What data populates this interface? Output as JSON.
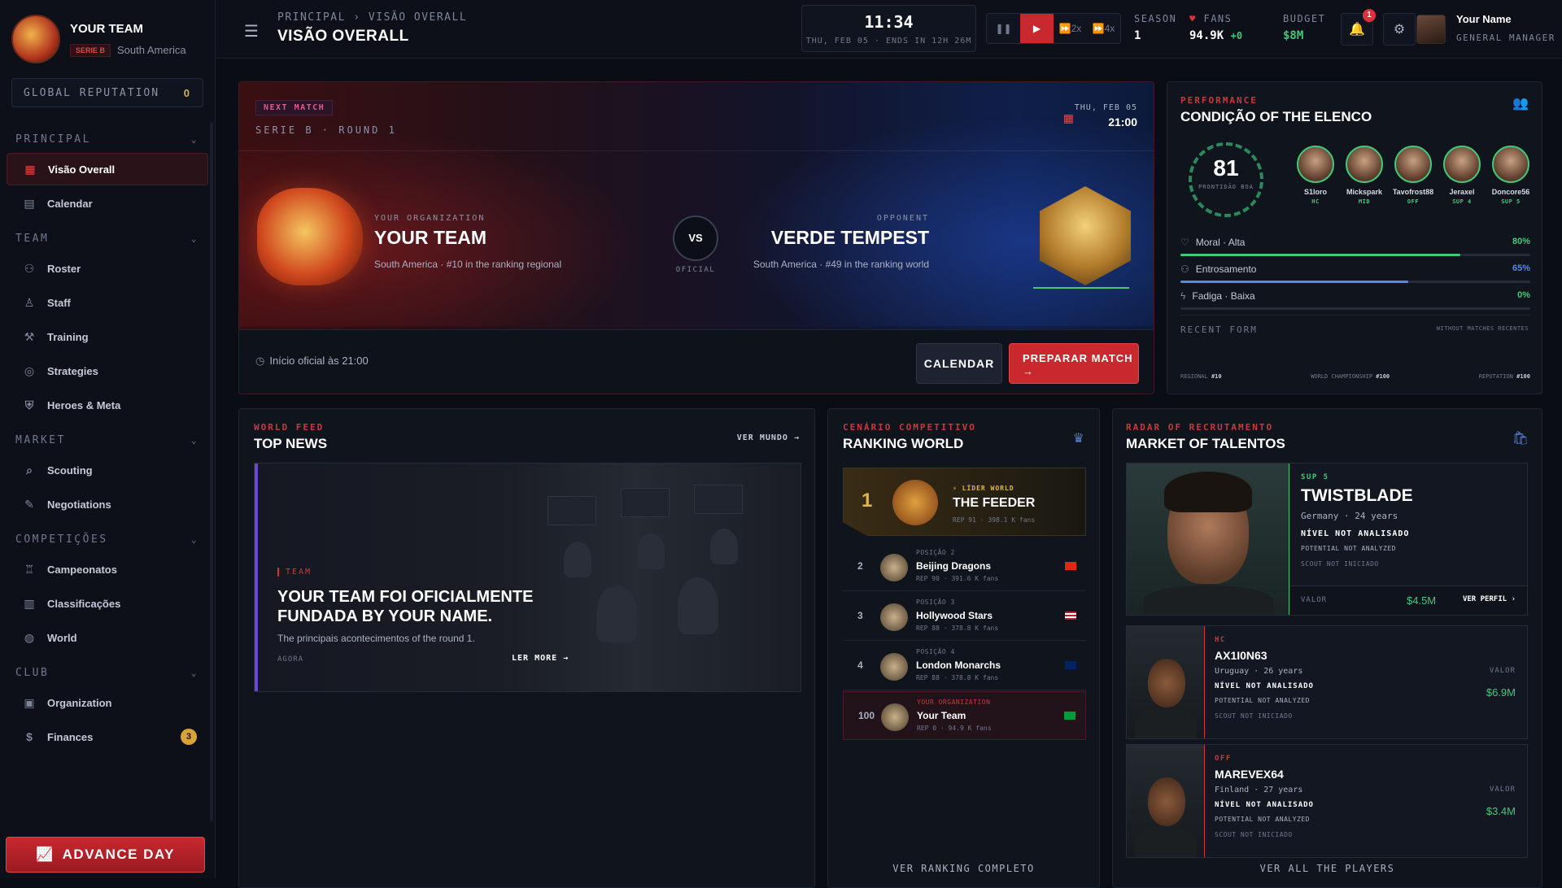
{
  "sidebar": {
    "team_name": "YOUR TEAM",
    "serie_badge": "SERIE B",
    "region": "South America",
    "reputation_label": "GLOBAL REPUTATION",
    "reputation_value": "0",
    "sections": [
      {
        "title": "PRINCIPAL",
        "items": [
          {
            "label": "Visão Overall",
            "icon": "grid-icon",
            "active": true
          },
          {
            "label": "Calendar",
            "icon": "calendar-icon"
          }
        ]
      },
      {
        "title": "TEAM",
        "items": [
          {
            "label": "Roster",
            "icon": "users-icon"
          },
          {
            "label": "Staff",
            "icon": "user-tie-icon"
          },
          {
            "label": "Training",
            "icon": "dumbbell-icon"
          },
          {
            "label": "Strategies",
            "icon": "target-icon"
          },
          {
            "label": "Heroes & Meta",
            "icon": "shield-icon"
          }
        ]
      },
      {
        "title": "MARKET",
        "items": [
          {
            "label": "Scouting",
            "icon": "search-icon"
          },
          {
            "label": "Negotiations",
            "icon": "edit-icon"
          }
        ]
      },
      {
        "title": "COMPETIÇÕES",
        "items": [
          {
            "label": "Campeonatos",
            "icon": "trophy-icon"
          },
          {
            "label": "Classificações",
            "icon": "bar-chart-icon"
          },
          {
            "label": "World",
            "icon": "globe-icon"
          }
        ]
      },
      {
        "title": "CLUB",
        "items": [
          {
            "label": "Organization",
            "icon": "building-icon"
          },
          {
            "label": "Finances",
            "icon": "dollar-icon",
            "badge": "3"
          }
        ]
      }
    ],
    "advance_label": "ADVANCE DAY"
  },
  "topbar": {
    "breadcrumb": "PRINCIPAL › VISÃO OVERALL",
    "title": "VISÃO OVERALL",
    "time": "11:34",
    "date": "THU, FEB 05 · ENDS IN 12H 26M",
    "speed_2x": "2x",
    "speed_4x": "4x",
    "season_label": "SEASON",
    "season_value": "1",
    "fans_label": "FANS",
    "fans_value": "94.9K",
    "fans_delta": "+0",
    "budget_label": "BUDGET",
    "budget_value": "$8M",
    "notifications": "1",
    "user_name": "Your Name",
    "user_role": "GENERAL MANAGER"
  },
  "match": {
    "badge": "NEXT MATCH",
    "round": "SERIE B · ROUND 1",
    "date": "THU, FEB 05",
    "time": "21:00",
    "home_label": "YOUR ORGANIZATION",
    "home_name": "YOUR TEAM",
    "home_sub": "South America · #10 in the ranking regional",
    "vs": "VS",
    "vs_label": "OFICIAL",
    "away_label": "OPPONENT",
    "away_name": "VERDE TEMPEST",
    "away_sub": "South America · #49 in the ranking world",
    "start_text": "Início oficial às 21:00",
    "calendar_button": "CALENDAR",
    "prepare_button": "PREPARAR MATCH →"
  },
  "performance": {
    "eyebrow": "PERFORMANCE",
    "title": "CONDIÇÃO OF THE ELENCO",
    "score": "81",
    "score_label": "PRONTIDÃO BOA",
    "players": [
      {
        "name": "S1loro",
        "pos": "HC"
      },
      {
        "name": "Mickspark",
        "pos": "MID"
      },
      {
        "name": "Tavofrost88",
        "pos": "OFF"
      },
      {
        "name": "Jeraxel",
        "pos": "SUP 4"
      },
      {
        "name": "Doncore56",
        "pos": "SUP 5"
      }
    ],
    "bars": [
      {
        "label": "Moral · Alta",
        "value": "80%",
        "fill": 0.8,
        "color": "#3fca7a",
        "icon": "heart-icon"
      },
      {
        "label": "Entrosamento",
        "value": "65%",
        "fill": 0.65,
        "color": "#5a8ae0",
        "icon": "users-icon"
      },
      {
        "label": "Fadiga · Baixa",
        "value": "0%",
        "fill": 0,
        "color": "#3fca7a",
        "icon": "bolt-icon"
      }
    ],
    "recent_form_label": "RECENT FORM",
    "recent_form_empty": "WITHOUT MATCHES RECENTES",
    "foot": [
      {
        "label": "REGIONAL",
        "value": "#10"
      },
      {
        "label": "WORLD CHAMPIONSHIP",
        "value": "#100"
      },
      {
        "label": "REPUTATION",
        "value": "#100"
      }
    ]
  },
  "news": {
    "eyebrow": "WORLD FEED",
    "title": "TOP NEWS",
    "link": "VER MUNDO →",
    "tag": "TEAM",
    "headline": "YOUR TEAM FOI OFICIALMENTE FUNDADA BY YOUR NAME.",
    "body": "The principais acontecimentos of the round 1.",
    "time": "AGORA",
    "more": "LER MORE →"
  },
  "ranking": {
    "eyebrow": "CENÁRIO COMPETITIVO",
    "title": "RANKING WORLD",
    "leader": {
      "pos": "1",
      "tag": "⚡ LÍDER WORLD",
      "name": "THE FEEDER",
      "rep": "REP 91 · 398.1 K fans"
    },
    "rows": [
      {
        "pos": "2",
        "label": "POSIÇÃO 2",
        "name": "Beijing Dragons",
        "rep": "REP 90 · 391.6 K fans",
        "flag": "cn"
      },
      {
        "pos": "3",
        "label": "POSIÇÃO 3",
        "name": "Hollywood Stars",
        "rep": "REP 88 · 378.8 K fans",
        "flag": "us"
      },
      {
        "pos": "4",
        "label": "POSIÇÃO 4",
        "name": "London Monarchs",
        "rep": "REP 88 · 378.8 K fans",
        "flag": "gb"
      },
      {
        "pos": "100",
        "label": "YOUR ORGANIZATION",
        "name": "Your Team",
        "rep": "REP 0 · 94.9 K fans",
        "flag": "br"
      }
    ],
    "footer": "VER RANKING COMPLETO"
  },
  "market": {
    "eyebrow": "RADAR OF RECRUTAMENTO",
    "title": "MARKET OF TALENTOS",
    "featured": {
      "role": "SUP 5",
      "name": "TWISTBLADE",
      "meta": "Germany · 24 years",
      "nivel": "NÍVEL NOT ANALISADO",
      "potential": "POTENTIAL NOT ANALYZED",
      "scout": "SCOUT NOT INICIADO",
      "value_label": "VALOR",
      "value": "$4.5M",
      "profile": "VER PERFIL ›"
    },
    "players": [
      {
        "role": "HC",
        "name": "AX1I0N63",
        "meta": "Uruguay · 26 years",
        "nivel": "NÍVEL NOT ANALISADO",
        "potential": "POTENTIAL NOT ANALYZED",
        "scout": "SCOUT NOT INICIADO",
        "value_label": "VALOR",
        "value": "$6.9M"
      },
      {
        "role": "OFF",
        "name": "MAREVEX64",
        "meta": "Finland · 27 years",
        "nivel": "NÍVEL NOT ANALISADO",
        "potential": "POTENTIAL NOT ANALYZED",
        "scout": "SCOUT NOT INICIADO",
        "value_label": "VALOR",
        "value": "$3.4M"
      }
    ],
    "footer": "VER ALL THE PLAYERS"
  }
}
